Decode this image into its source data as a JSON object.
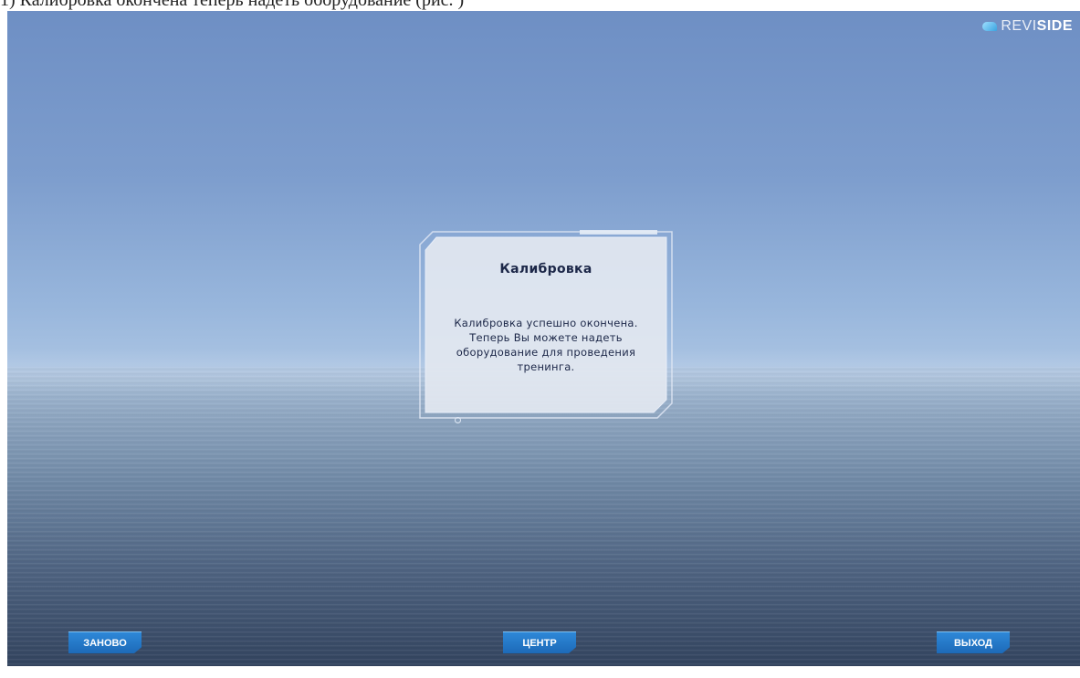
{
  "document_caption": "1) Калибровка окончена теперь надеть оборудование (рис. )",
  "logo": {
    "light": "REVI",
    "bold": "SIDE"
  },
  "dialog": {
    "title": "Калибровка",
    "body_lines": [
      "Калибровка успешно окончена.",
      "Теперь Вы можете надеть",
      "оборудование для проведения",
      "тренинга."
    ]
  },
  "buttons": {
    "restart": "ЗАНОВО",
    "center": "ЦЕНТР",
    "exit": "ВЫХОД"
  },
  "colors": {
    "button_blue": "#1d6ab8",
    "dialog_text": "#1c2748",
    "sky": "#7d9dcd",
    "sea": "#33445f"
  }
}
